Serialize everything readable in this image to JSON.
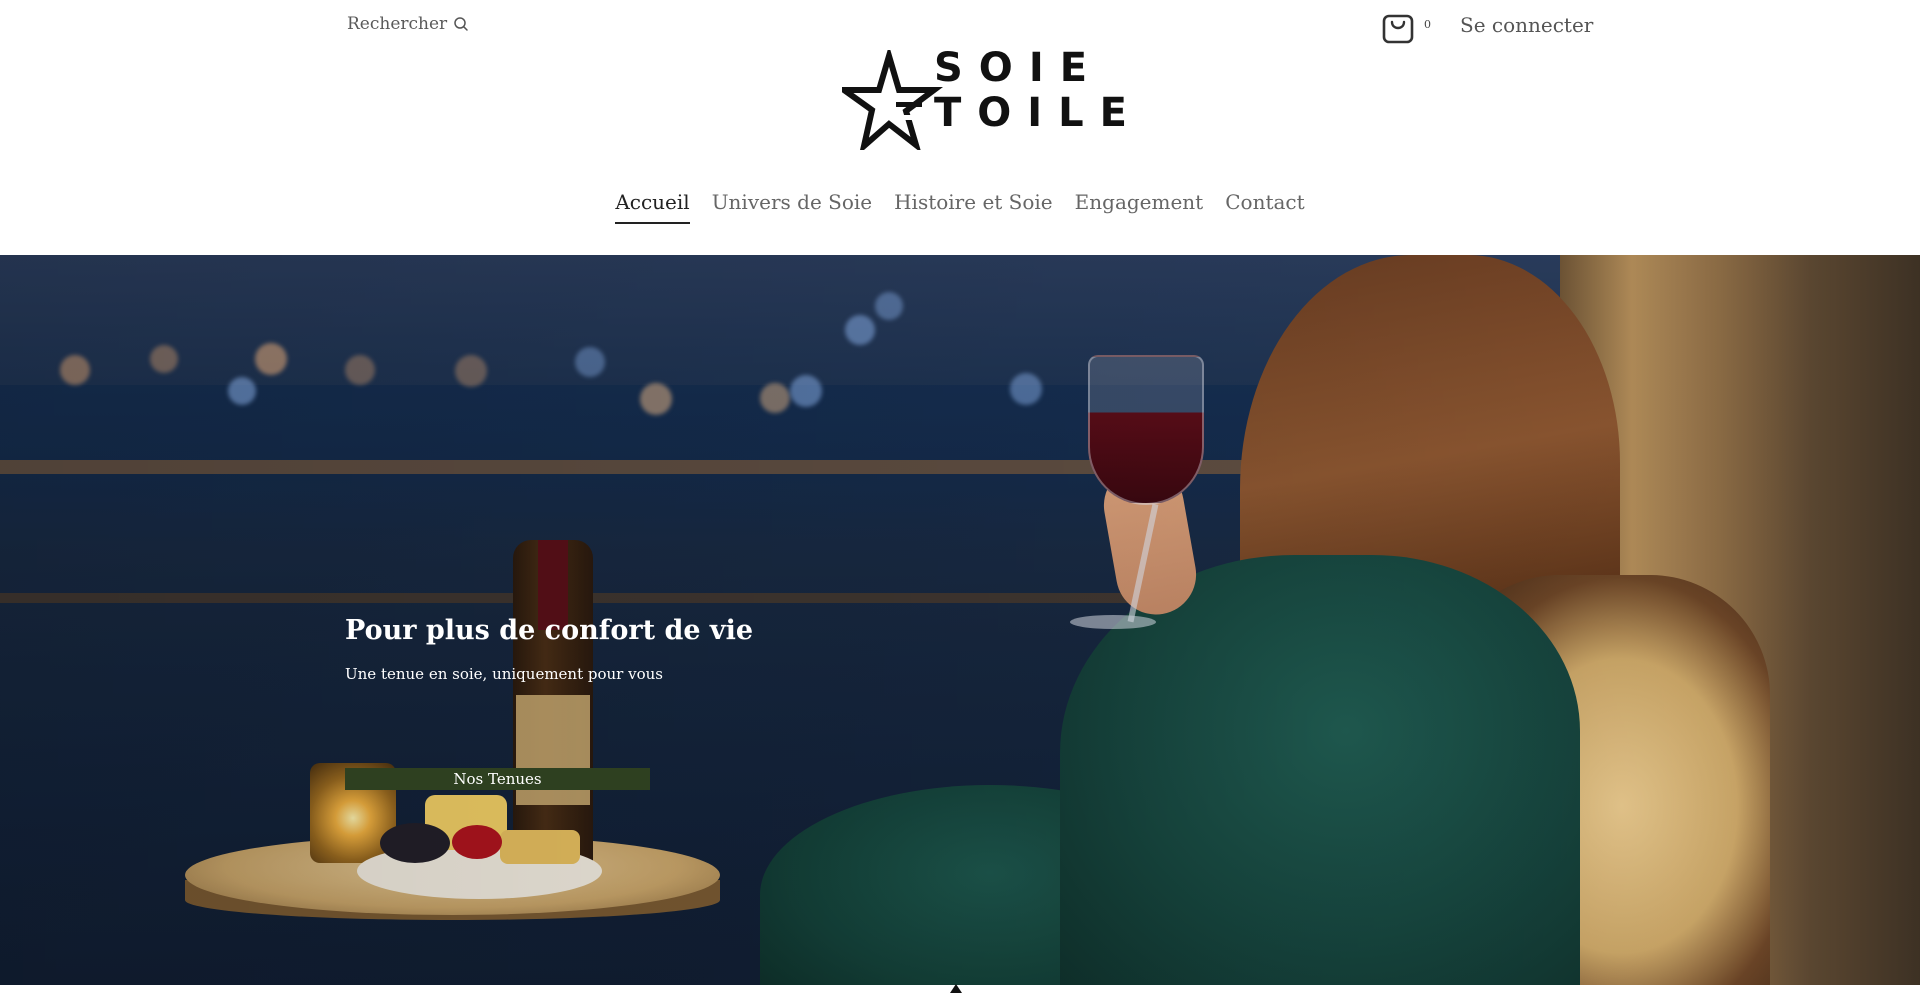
{
  "header": {
    "search_label": "Rechercher",
    "search_icon": "search-icon",
    "cart_icon": "shopping-bag-icon",
    "cart_count": "0",
    "login_label": "Se connecter"
  },
  "brand": {
    "line1": "SOIE",
    "line2": "TOILE",
    "logo_icon": "star-logo-icon"
  },
  "nav": {
    "items": [
      {
        "label": "Accueil",
        "active": true
      },
      {
        "label": "Univers de Soie",
        "active": false
      },
      {
        "label": "Histoire et Soie",
        "active": false
      },
      {
        "label": "Engagement",
        "active": false
      },
      {
        "label": "Contact",
        "active": false
      }
    ]
  },
  "hero": {
    "title": "Pour plus de confort de vie",
    "subtitle": "Une tenue en soie, uniquement pour vous",
    "button_label": "Nos Tenues",
    "button_color": "#2e4020"
  }
}
